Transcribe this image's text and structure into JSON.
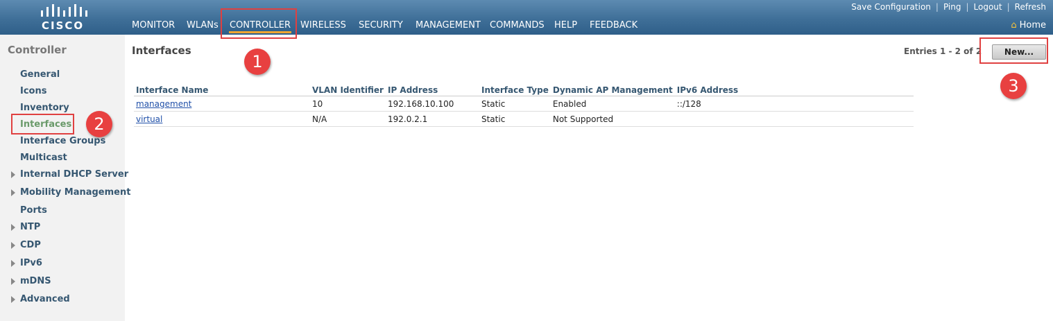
{
  "brand": {
    "logo_text": "CISCO"
  },
  "top_links": [
    "Save Configuration",
    "Ping",
    "Logout",
    "Refresh"
  ],
  "nav": [
    "MONITOR",
    "WLANs",
    "CONTROLLER",
    "WIRELESS",
    "SECURITY",
    "MANAGEMENT",
    "COMMANDS",
    "HELP",
    "FEEDBACK"
  ],
  "nav_active": "CONTROLLER",
  "home_label": "Home",
  "sidebar": {
    "title": "Controller",
    "items": [
      {
        "label": "General",
        "expandable": false
      },
      {
        "label": "Icons",
        "expandable": false
      },
      {
        "label": "Inventory",
        "expandable": false
      },
      {
        "label": "Interfaces",
        "expandable": false,
        "active": true
      },
      {
        "label": "Interface Groups",
        "expandable": false
      },
      {
        "label": "Multicast",
        "expandable": false
      },
      {
        "label": "Internal DHCP Server",
        "expandable": true
      },
      {
        "label": "Mobility Management",
        "expandable": true
      },
      {
        "label": "Ports",
        "expandable": false
      },
      {
        "label": "NTP",
        "expandable": true
      },
      {
        "label": "CDP",
        "expandable": true
      },
      {
        "label": "IPv6",
        "expandable": true
      },
      {
        "label": "mDNS",
        "expandable": true
      },
      {
        "label": "Advanced",
        "expandable": true
      }
    ]
  },
  "main": {
    "title": "Interfaces",
    "entries": "Entries 1 - 2 of 2",
    "new_button": "New...",
    "columns": [
      "Interface Name",
      "VLAN Identifier",
      "IP Address",
      "Interface Type",
      "Dynamic AP Management",
      "IPv6 Address"
    ],
    "rows": [
      [
        "management",
        "10",
        "192.168.10.100",
        "Static",
        "Enabled",
        "::/128"
      ],
      [
        "virtual",
        "N/A",
        "192.0.2.1",
        "Static",
        "Not Supported",
        ""
      ]
    ]
  },
  "annotations": [
    "1",
    "2",
    "3"
  ],
  "colors": {
    "header": "#3f6f98",
    "accent_underline": "#f0a630",
    "callout_red": "#e84040",
    "link_blue": "#1f4fa8"
  }
}
